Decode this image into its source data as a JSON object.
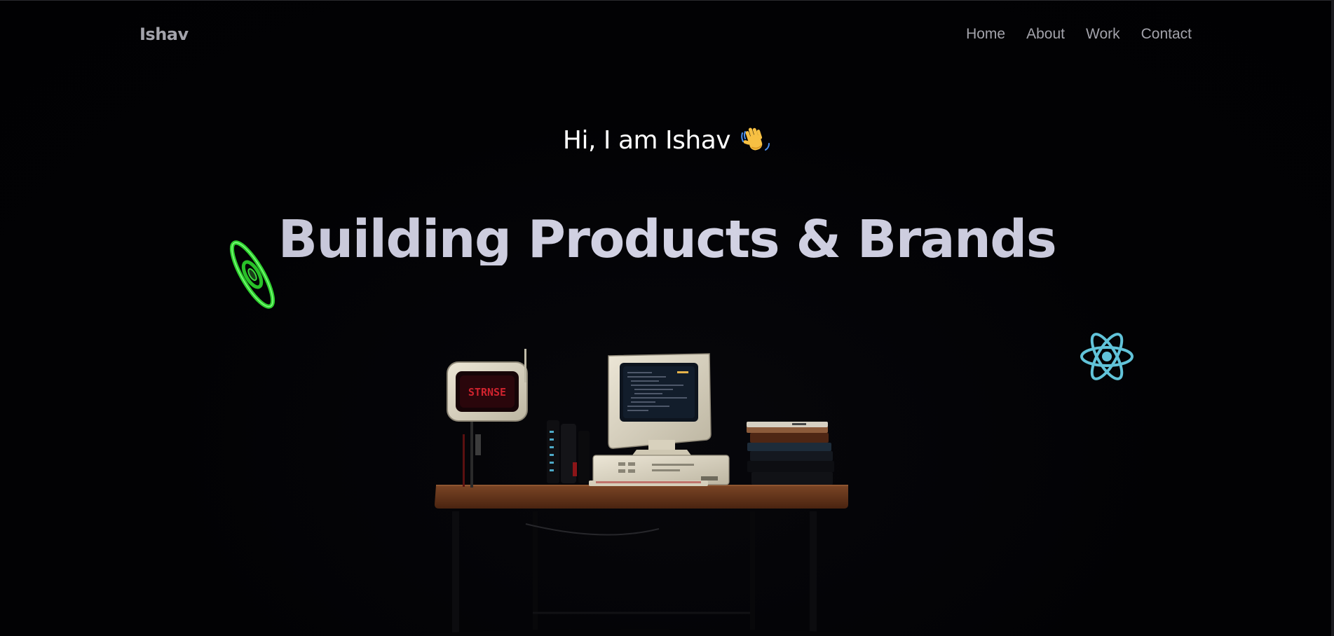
{
  "nav": {
    "brand": "Ishav",
    "links": [
      {
        "label": "Home"
      },
      {
        "label": "About"
      },
      {
        "label": "Work"
      },
      {
        "label": "Contact"
      }
    ]
  },
  "hero": {
    "greeting": "Hi, I am Ishav",
    "greeting_emoji": "waving-hand-icon",
    "title": "Building Products & Brands"
  },
  "scene": {
    "sign_text": "STRNSE",
    "floating_icons": [
      "ring-icon",
      "react-icon"
    ]
  },
  "colors": {
    "background": "#010103",
    "nav_text": "#a3a3ab",
    "title": "#c3c3d6",
    "ring_green": "#39e539",
    "react_blue": "#61c3d9",
    "desk_wood": "#5e3218"
  }
}
